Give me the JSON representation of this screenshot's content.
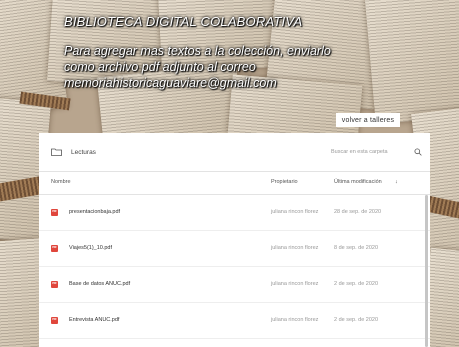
{
  "header": {
    "title": "BIBLIOTECA DIGITAL COLABORATIVA",
    "lines": [
      "Para agregar mas textos a la colección, enviarlo",
      "como archivo pdf adjunto al correo",
      "memoriahistoricaguaviare@gmail.com"
    ]
  },
  "return_button": {
    "label": "volver a talleres"
  },
  "panel": {
    "folder_name": "Lecturas",
    "search_placeholder": "Buscar en esta carpeta",
    "columns": {
      "name": "Nombre",
      "owner": "Propietario",
      "modified": "Última modificación",
      "sort_indicator": "↓"
    },
    "file_type_badge": "PDF",
    "files": [
      {
        "name": "presentacionbaja.pdf",
        "owner": "juliana rincon florez",
        "modified": "28 de sep. de 2020"
      },
      {
        "name": "Viajes5(1)_10.pdf",
        "owner": "juliana rincon florez",
        "modified": "8 de sep. de 2020"
      },
      {
        "name": "Base de datos ANUC.pdf",
        "owner": "juliana rincon florez",
        "modified": "2 de sep. de 2020"
      },
      {
        "name": "Entrevista ANUC.pdf",
        "owner": "juliana rincon florez",
        "modified": "2 de sep. de 2020"
      }
    ]
  },
  "icons": {
    "folder": "folder-icon",
    "search": "search-icon",
    "file": "pdf-file-icon"
  },
  "colors": {
    "pdf_badge": "#e0463c",
    "panel_background": "#ffffff",
    "headline_text": "#ffffff"
  }
}
